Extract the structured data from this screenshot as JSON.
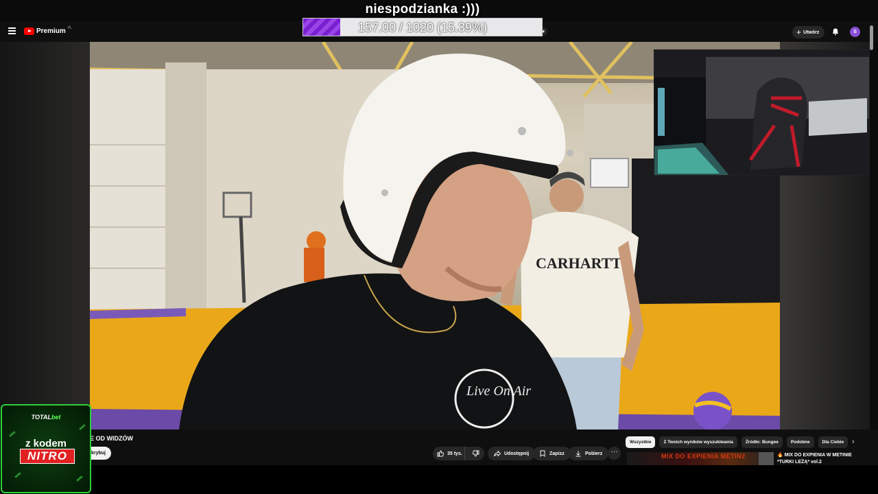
{
  "stream_overlay": {
    "title": "niespodzianka :)))",
    "goal_text": "157.00 / 1020 (15.39%)",
    "goal_fraction": 0.1539,
    "goal_fill_color": "#7a1fd0"
  },
  "header": {
    "logo_text": "Premium",
    "country_code": "PL",
    "create_label": "Utwórz",
    "avatar_initial": "S",
    "icons": [
      "menu-icon",
      "youtube-logo-icon",
      "mic-icon",
      "plus-icon",
      "bell-icon"
    ]
  },
  "video": {
    "title_visible": "E OD WIDZÓW",
    "subscribe_label": "krybuj",
    "shirt_text": "CARHARTT",
    "tee_print": "Live On Air"
  },
  "actions": {
    "likes": "35 tys.",
    "share": "Udostępnij",
    "save": "Zapisz",
    "download": "Pobierz",
    "more": "···"
  },
  "chips": [
    "Wszystkie",
    "Z Twoich wyników wyszukiwania",
    "Źródło: Bungee",
    "Podobne",
    "Dla Ciebie"
  ],
  "recommendation": {
    "title": "🔥 MIX DO EXPIENIA W METINIE *TURKI LEŻĄ* vol.2",
    "thumb_text": "MIX DO EXPIENIA METIN2"
  },
  "sponsor": {
    "brand_prefix": "TOTAL",
    "brand_suffix": "bet",
    "line1": "z kodem",
    "code": "NITRO",
    "accent_color": "#2bd13a"
  }
}
